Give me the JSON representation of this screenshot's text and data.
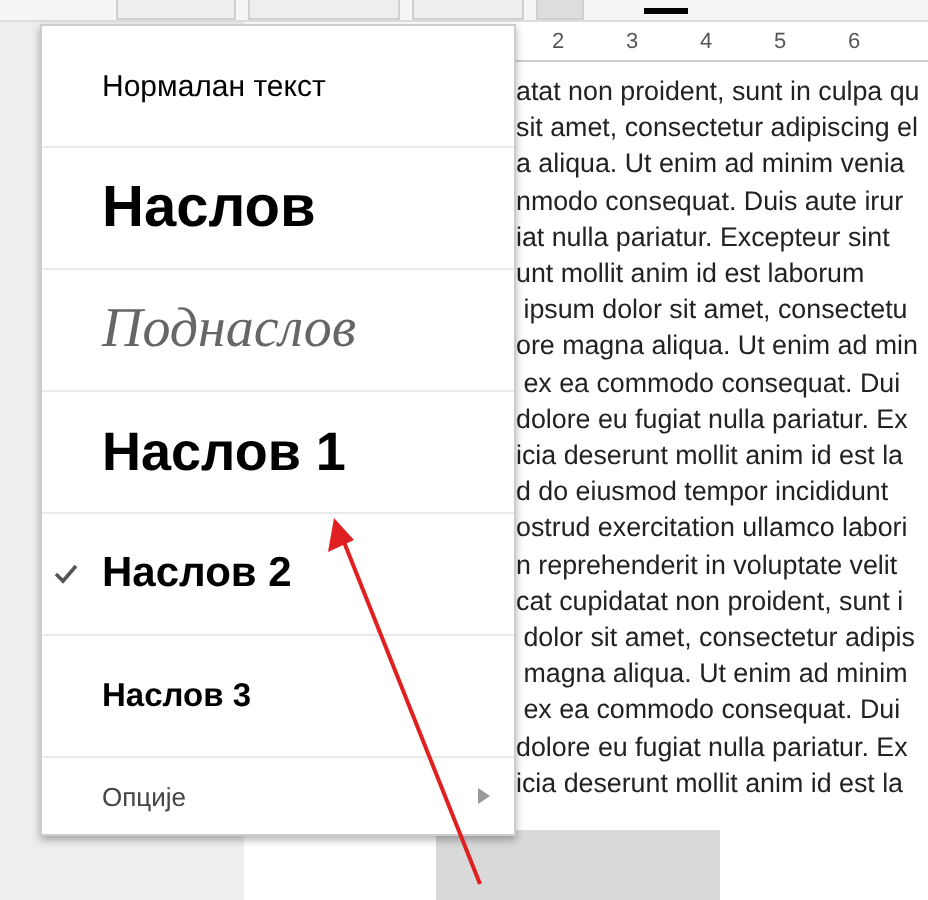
{
  "ruler": {
    "labels": [
      "2",
      "3",
      "4",
      "5",
      "6"
    ]
  },
  "document": {
    "lines": [
      "atat non proident, sunt in culpa qu",
      "sit amet, consectetur adipiscing el",
      "a aliqua. Ut enim ad minim venia",
      "nmodo consequat. Duis aute irur",
      "iat nulla pariatur. Excepteur sint",
      "unt mollit anim id est laborum",
      " ipsum dolor sit amet, consectetu",
      "ore magna aliqua. Ut enim ad min",
      " ex ea commodo consequat. Dui",
      "dolore eu fugiat nulla pariatur. Ex",
      "icia deserunt mollit anim id est la",
      "d do eiusmod tempor incididunt",
      "ostrud exercitation ullamco labori",
      "n reprehenderit in voluptate velit",
      "cat cupidatat non proident, sunt i",
      " dolor sit amet, consectetur adipis",
      " magna aliqua. Ut enim ad minim",
      " ex ea commodo consequat. Dui",
      "dolore eu fugiat nulla pariatur. Ex",
      "icia deserunt mollit anim id est la"
    ]
  },
  "style_menu": {
    "items": [
      {
        "kind": "normal",
        "label": "Нормалан текст",
        "selected": false
      },
      {
        "kind": "title",
        "label": "Наслов",
        "selected": false
      },
      {
        "kind": "subtitle",
        "label": "Поднаслов",
        "selected": false
      },
      {
        "kind": "heading1",
        "label": "Наслов 1",
        "selected": false
      },
      {
        "kind": "heading2",
        "label": "Наслов 2",
        "selected": true
      },
      {
        "kind": "heading3",
        "label": "Наслов 3",
        "selected": false
      },
      {
        "kind": "options",
        "label": "Опције",
        "selected": false
      }
    ]
  }
}
